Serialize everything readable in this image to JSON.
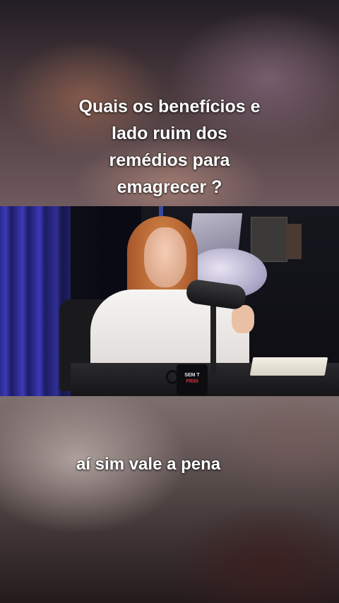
{
  "overlay": {
    "question_lines": [
      "Quais os benefícios e",
      "lado ruim dos",
      "remédios para",
      "emagrecer ?"
    ],
    "subtitle": "aí sim vale a pena"
  },
  "video": {
    "mug_text_top": "SEM T",
    "mug_text_bottom": "FRIIII"
  },
  "colors": {
    "caption_text": "#ffffff",
    "curtain_blue": "#3b3ab8",
    "shirt_white": "#f6f4f2",
    "hair_red": "#a8572a"
  }
}
